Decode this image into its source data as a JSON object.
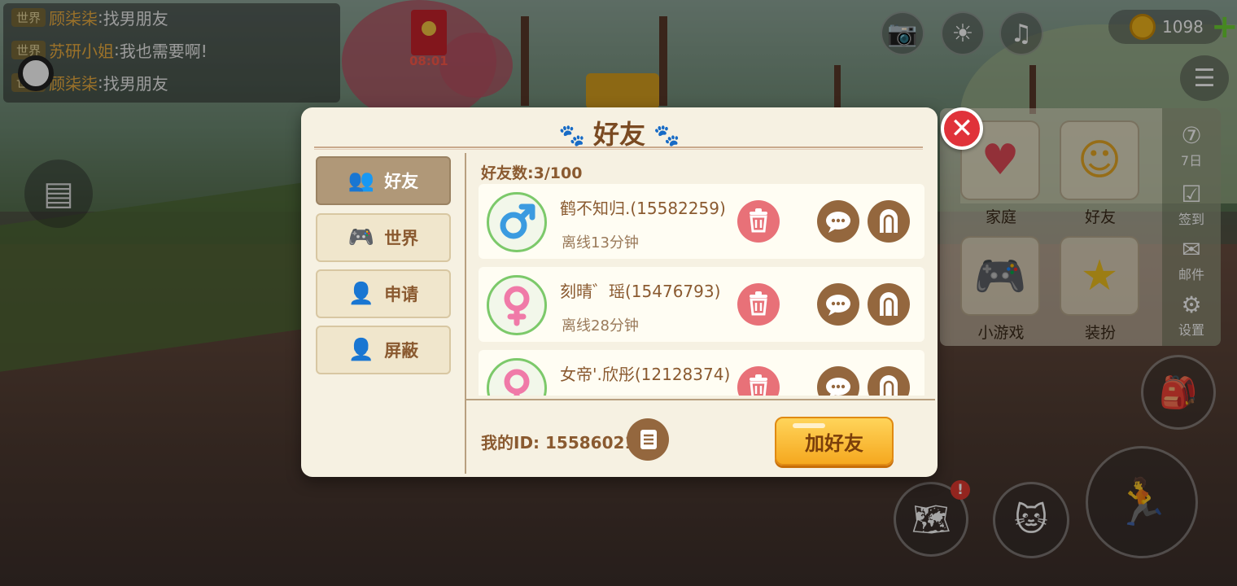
{
  "chat": [
    {
      "tag": "世界",
      "name": "顾柒柒",
      "sep": ":",
      "msg": "找男朋友"
    },
    {
      "tag": "世界",
      "name": "苏研小姐",
      "sep": ":",
      "msg": "我也需要啊!"
    },
    {
      "tag": "世界",
      "name": "顾柒柒",
      "sep": ":",
      "msg": "找男朋友"
    }
  ],
  "event": {
    "timer": "08:01"
  },
  "hud": {
    "coins": "1098",
    "plus": "+"
  },
  "side_menu": {
    "items": [
      {
        "label": "家庭",
        "icon": "heart-icon"
      },
      {
        "label": "好友",
        "icon": "friends-icon"
      },
      {
        "label": "小游戏",
        "icon": "gamepad-icon"
      },
      {
        "label": "装扮",
        "icon": "magic-wand-icon"
      }
    ],
    "strip": [
      {
        "label": "7日",
        "icon": "seven-day-icon"
      },
      {
        "label": "签到",
        "icon": "checkin-icon"
      },
      {
        "label": "邮件",
        "icon": "mail-icon"
      },
      {
        "label": "设置",
        "icon": "gear-icon"
      }
    ],
    "map_alert": "!"
  },
  "dialog": {
    "title": "好友",
    "close": "✕",
    "tabs": [
      {
        "label": "好友",
        "icon": "friends-icon",
        "active": true
      },
      {
        "label": "世界",
        "icon": "gamepad-icon",
        "active": false
      },
      {
        "label": "申请",
        "icon": "add-user-icon",
        "active": false
      },
      {
        "label": "屏蔽",
        "icon": "block-user-icon",
        "active": false
      }
    ],
    "count_label": "好友数:3/100",
    "friends": [
      {
        "name": "鹤不知归.(15582259)",
        "status": "离线13分钟",
        "gender": "male"
      },
      {
        "name": "刻晴゛瑶(15476793)",
        "status": "离线28分钟",
        "gender": "female"
      },
      {
        "name": "女帝'.欣彤(12128374)",
        "status": "",
        "gender": "female"
      }
    ],
    "my_id_label": "我的ID: 15586021",
    "add_button": "加好友"
  },
  "colors": {
    "accent_brown": "#94673e",
    "delete_red": "#e87178",
    "title_brown": "#7a4a22",
    "button_gold": "#f5a81f"
  }
}
